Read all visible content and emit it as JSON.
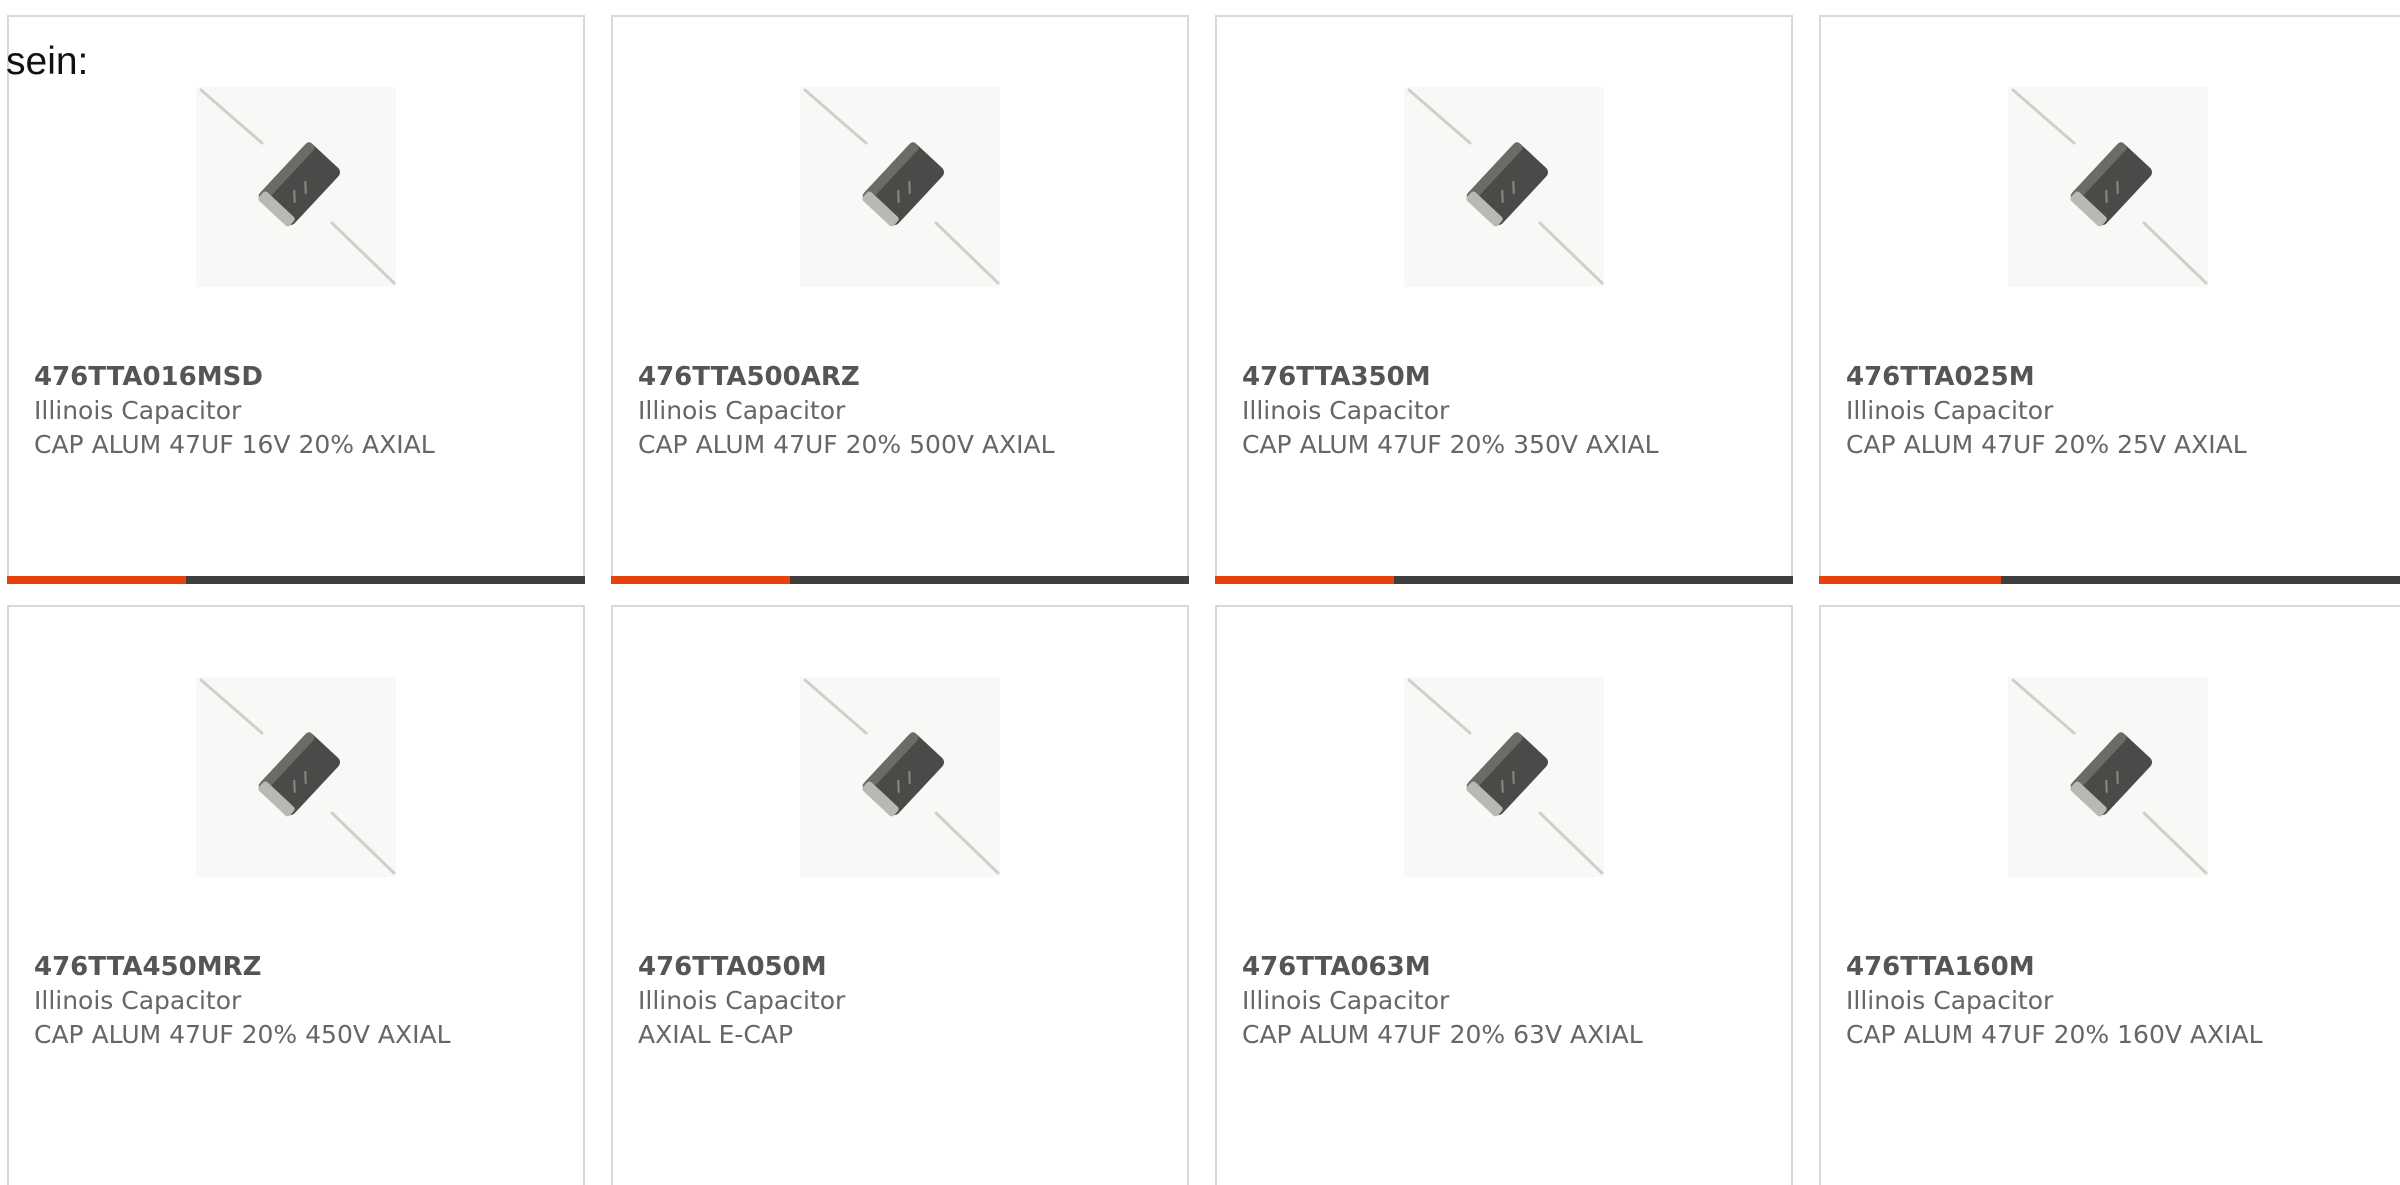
{
  "intro_text": "sein:",
  "colors": {
    "accent": "#e8420c",
    "bar_track": "#3f3f3f",
    "card_border": "#d9d9d9",
    "text_muted": "#666666"
  },
  "products": [
    {
      "part_no": "476TTA016MSD",
      "manufacturer": "Illinois Capacitor",
      "description": "CAP ALUM 47UF 16V 20% AXIAL",
      "image_icon": "axial-capacitor-image",
      "highlight_fraction": 0.31
    },
    {
      "part_no": "476TTA500ARZ",
      "manufacturer": "Illinois Capacitor",
      "description": "CAP ALUM 47UF 20% 500V AXIAL",
      "image_icon": "axial-capacitor-image",
      "highlight_fraction": 0.31
    },
    {
      "part_no": "476TTA350M",
      "manufacturer": "Illinois Capacitor",
      "description": "CAP ALUM 47UF 20% 350V AXIAL",
      "image_icon": "axial-capacitor-image",
      "highlight_fraction": 0.31
    },
    {
      "part_no": "476TTA025M",
      "manufacturer": "Illinois Capacitor",
      "description": "CAP ALUM 47UF 20% 25V AXIAL",
      "image_icon": "axial-capacitor-image",
      "highlight_fraction": 0.31
    },
    {
      "part_no": "476TTA450MRZ",
      "manufacturer": "Illinois Capacitor",
      "description": "CAP ALUM 47UF 20% 450V AXIAL",
      "image_icon": "axial-capacitor-image"
    },
    {
      "part_no": "476TTA050M",
      "manufacturer": "Illinois Capacitor",
      "description": "AXIAL E-CAP",
      "image_icon": "axial-capacitor-image"
    },
    {
      "part_no": "476TTA063M",
      "manufacturer": "Illinois Capacitor",
      "description": "CAP ALUM 47UF 20% 63V AXIAL",
      "image_icon": "axial-capacitor-image"
    },
    {
      "part_no": "476TTA160M",
      "manufacturer": "Illinois Capacitor",
      "description": "CAP ALUM 47UF 20% 160V AXIAL",
      "image_icon": "axial-capacitor-image"
    }
  ]
}
